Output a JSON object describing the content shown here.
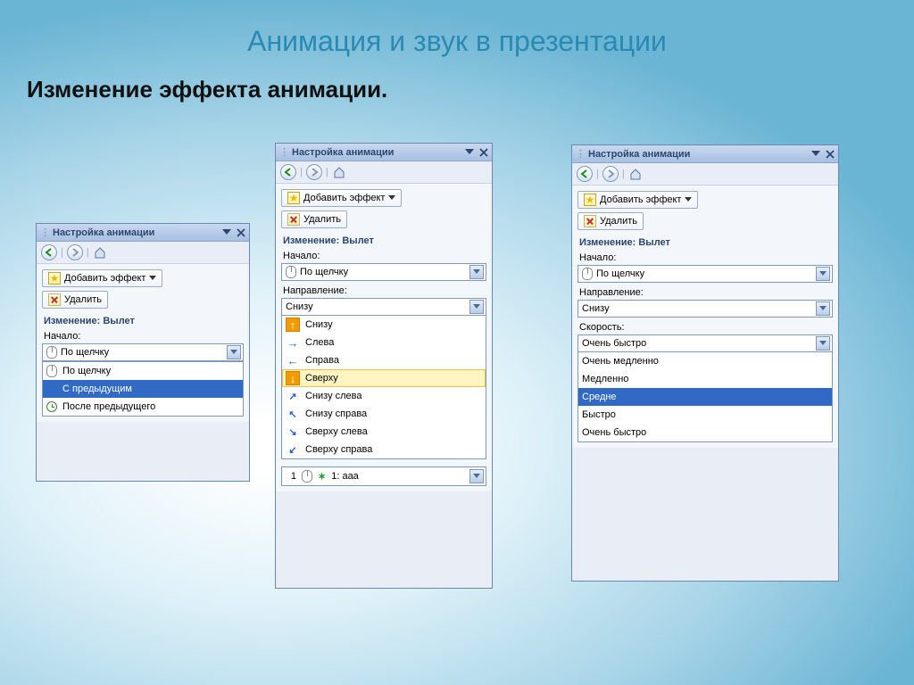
{
  "titles": {
    "slide_title": "Анимация и звук в презентации",
    "subtitle": "Изменение эффекта анимации."
  },
  "pane_title": "Настройка анимации",
  "buttons": {
    "add_effect": "Добавить эффект",
    "remove": "Удалить"
  },
  "section_change": "Изменение: Вылет",
  "labels": {
    "start": "Начало:",
    "direction": "Направление:",
    "speed": "Скорость:"
  },
  "start": {
    "value": "По щелчку",
    "options": [
      "По щелчку",
      "С предыдущим",
      "После предыдущего"
    ],
    "selected_index": 1
  },
  "direction": {
    "value": "Снизу",
    "options": [
      "Снизу",
      "Слева",
      "Справа",
      "Сверху",
      "Снизу слева",
      "Снизу справа",
      "Сверху слева",
      "Сверху справа"
    ],
    "highlighted_index": 3
  },
  "speed": {
    "value": "Очень быстро",
    "options": [
      "Очень медленно",
      "Медленно",
      "Средне",
      "Быстро",
      "Очень быстро"
    ],
    "selected_index": 2
  },
  "effect_item": "1: aaa"
}
